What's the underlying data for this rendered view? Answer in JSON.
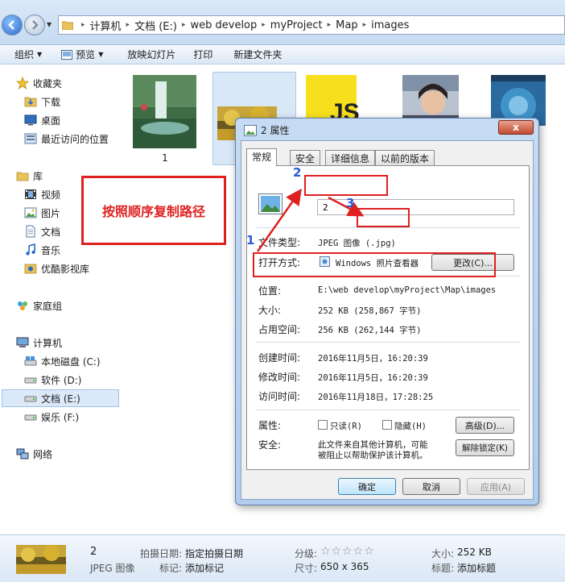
{
  "breadcrumb": [
    "计算机",
    "文档 (E:)",
    "web develop",
    "myProject",
    "Map",
    "images"
  ],
  "toolbar": {
    "organize": "组织",
    "preview": "预览",
    "slideshow": "放映幻灯片",
    "print": "打印",
    "new_folder": "新建文件夹"
  },
  "nav": {
    "favorites": "收藏夹",
    "downloads": "下载",
    "desktop": "桌面",
    "recent": "最近访问的位置",
    "libraries": "库",
    "videos": "视频",
    "pictures": "图片",
    "documents": "文档",
    "music": "音乐",
    "youku": "优酷影视库",
    "homegroup": "家庭组",
    "computer": "计算机",
    "drive_c": "本地磁盘 (C:)",
    "drive_d": "软件 (D:)",
    "drive_e": "文档 (E:)",
    "drive_f": "娱乐 (F:)",
    "network": "网络"
  },
  "files": {
    "thumb1_label": "1",
    "js_text": "JS"
  },
  "annotation": {
    "text": "按照顺序复制路径",
    "n1": "1",
    "n2": "2",
    "n3": "3"
  },
  "dialog": {
    "title": "2 属性",
    "close": "x",
    "tabs": [
      "常规",
      "安全",
      "详细信息",
      "以前的版本"
    ],
    "name_value": "2",
    "type_label": "文件类型:",
    "type_value": "JPEG 图像 (.jpg)",
    "openwith_label": "打开方式:",
    "openwith_value": "Windows 照片查看器",
    "change_btn": "更改(C)...",
    "location_label": "位置:",
    "location_value": "E:\\web develop\\myProject\\Map\\images",
    "size_label": "大小:",
    "size_value": "252 KB (258,867 字节)",
    "disk_label": "占用空间:",
    "disk_value": "256 KB (262,144 字节)",
    "created_label": "创建时间:",
    "created_value": "2016年11月5日，16:20:39",
    "modified_label": "修改时间:",
    "modified_value": "2016年11月5日，16:20:39",
    "accessed_label": "访问时间:",
    "accessed_value": "2016年11月18日，17:28:25",
    "attr_label": "属性:",
    "readonly": "只读(R)",
    "hidden": "隐藏(H)",
    "advanced_btn": "高级(D)...",
    "security_label": "安全:",
    "security_text_1": "此文件来自其他计算机，可能",
    "security_text_2": "被阻止以帮助保护该计算机。",
    "unblock_btn": "解除锁定(K)",
    "ok": "确定",
    "cancel": "取消",
    "apply": "应用(A)"
  },
  "details": {
    "name": "2",
    "type": "JPEG 图像",
    "date_key": "拍摄日期:",
    "date_val": "指定拍摄日期",
    "tags_key": "标记:",
    "tags_val": "添加标记",
    "rating_key": "分级:",
    "rating_stars": "☆☆☆☆☆",
    "dim_key": "尺寸:",
    "dim_val": "650 x 365",
    "size_key": "大小:",
    "size_val": "252 KB",
    "title_key": "标题:",
    "title_val": "添加标题"
  },
  "colors": {
    "annotation_red": "#e02020",
    "annotation_blue": "#2a5bd7",
    "js_yellow": "#f7df1e"
  }
}
